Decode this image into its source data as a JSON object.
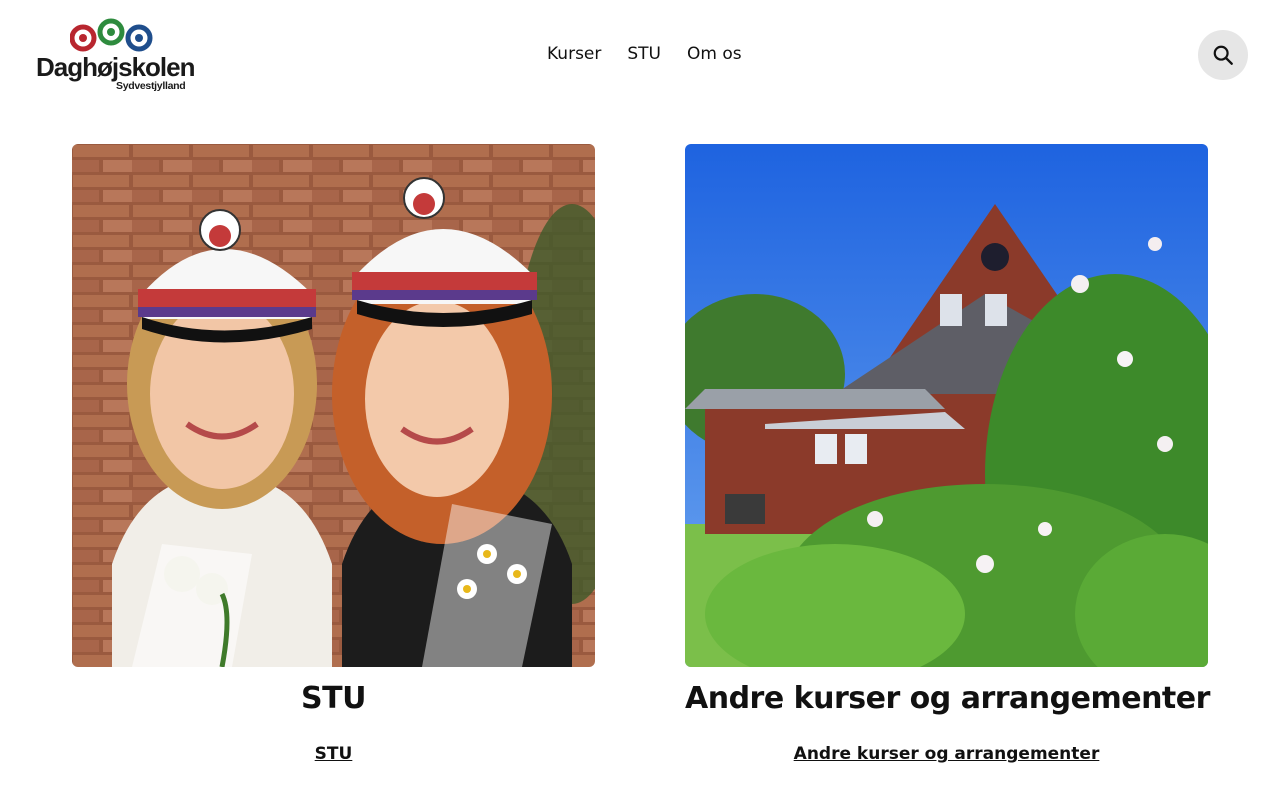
{
  "header": {
    "logo": {
      "name": "Daghøjskolen",
      "subtitle": "Sydvestjylland"
    },
    "nav": [
      {
        "label": "Kurser"
      },
      {
        "label": "STU"
      },
      {
        "label": "Om os"
      }
    ],
    "search": {
      "icon": "search-icon"
    }
  },
  "cards": [
    {
      "title": "STU",
      "link": "STU",
      "image": "students-in-graduation-caps-photo"
    },
    {
      "title": "Andre kurser og arrangementer",
      "link": "Andre kurser og arrangementer",
      "image": "school-building-with-blossom-photo"
    }
  ],
  "colors": {
    "logo_red": "#b8262f",
    "logo_green": "#2e8b3e",
    "logo_blue": "#1f4e8c",
    "search_bg": "#e6e6e6",
    "text": "#111111"
  }
}
